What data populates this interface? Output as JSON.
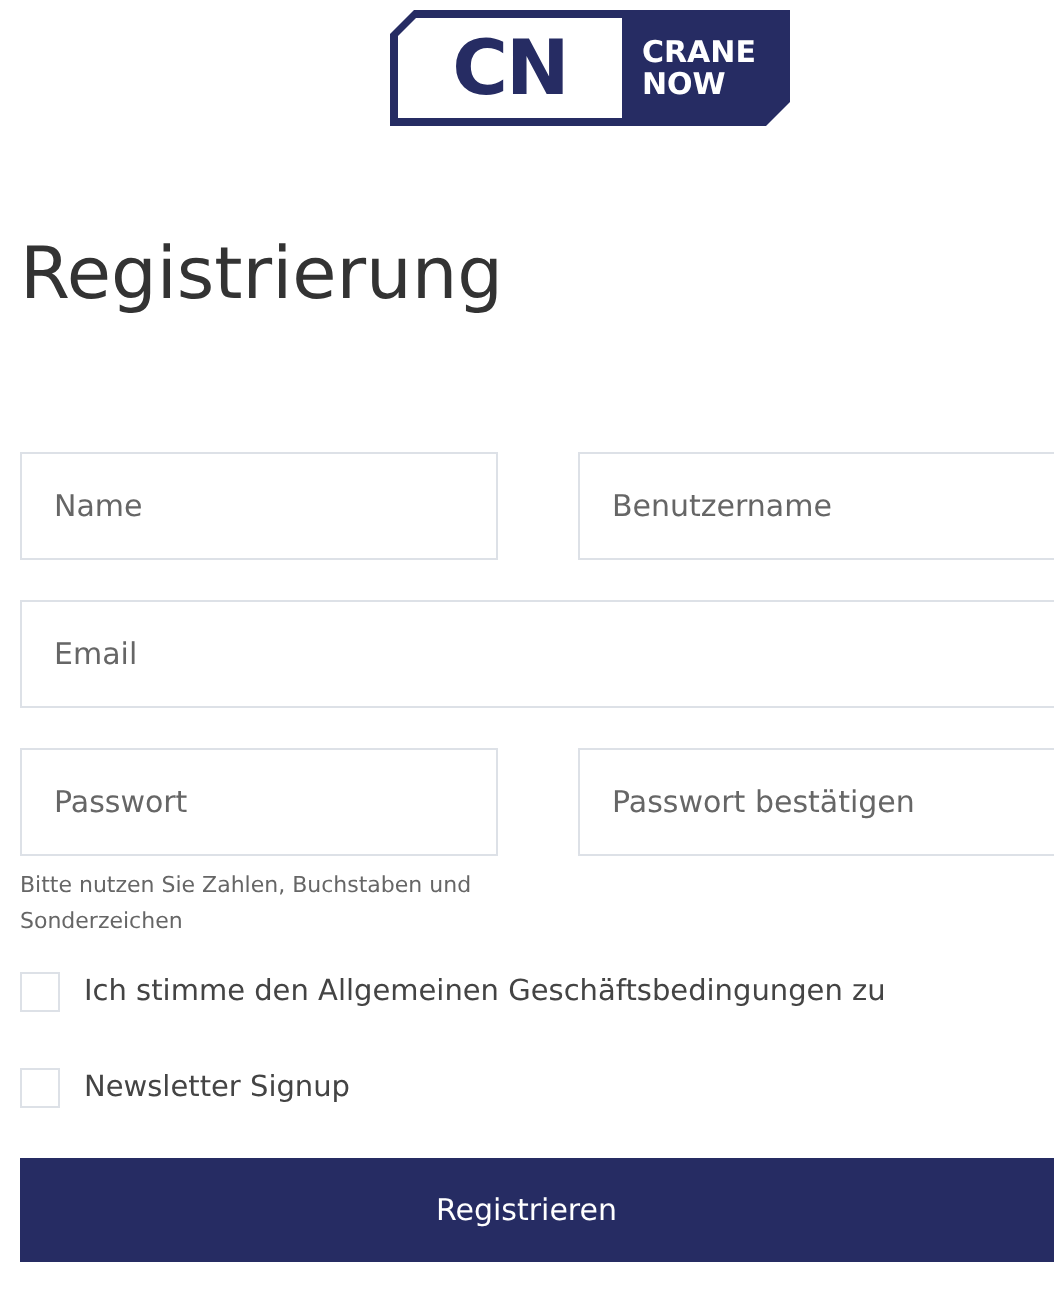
{
  "logo": {
    "mark": "CN",
    "line1": "CRANE",
    "line2": "NOW"
  },
  "title": "Registrierung",
  "field_rows": [
    {
      "fields": [
        {
          "placeholder": "Name"
        },
        {
          "placeholder": "Benutzername"
        }
      ]
    },
    {
      "fields": [
        {
          "placeholder": "Email"
        }
      ]
    },
    {
      "fields": [
        {
          "placeholder": "Passwort"
        },
        {
          "placeholder": "Passwort bestätigen"
        }
      ]
    }
  ],
  "password_hint": "Bitte nutzen Sie Zahlen, Buchstaben und Sonderzeichen",
  "checkboxes": [
    {
      "label": "Ich stimme den Allgemeinen Geschäftsbedingungen zu",
      "checked": false
    },
    {
      "label": "Newsletter Signup",
      "checked": false
    }
  ],
  "submit": "Registrieren"
}
